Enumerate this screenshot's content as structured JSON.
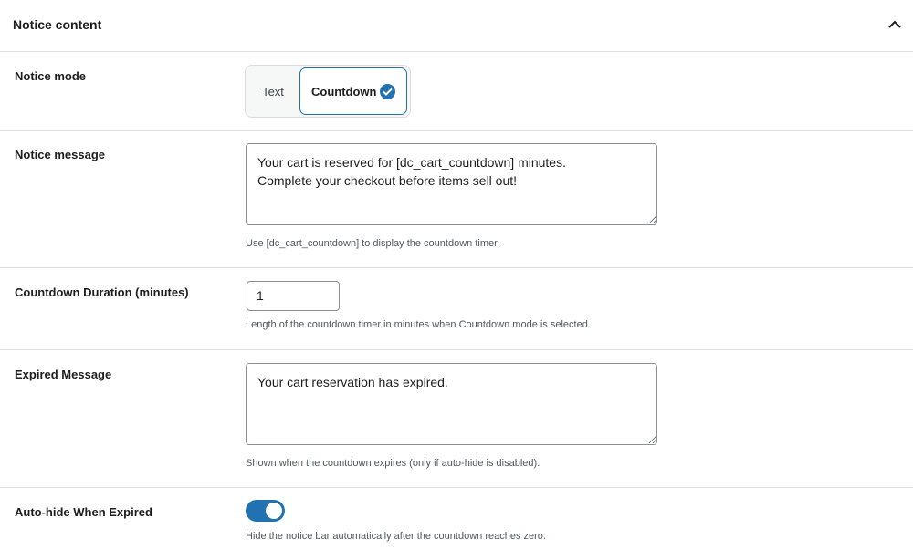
{
  "panel": {
    "title": "Notice content",
    "collapse_icon": "chevron-up-icon"
  },
  "notice_mode": {
    "label": "Notice mode",
    "options": [
      "Text",
      "Countdown"
    ],
    "selected": "Countdown"
  },
  "notice_message": {
    "label": "Notice message",
    "value": "Your cart is reserved for [dc_cart_countdown] minutes.\nComplete your checkout before items sell out!",
    "help": "Use [dc_cart_countdown] to display the countdown timer."
  },
  "countdown_duration": {
    "label": "Countdown Duration (minutes)",
    "value": "1",
    "help": "Length of the countdown timer in minutes when Countdown mode is selected."
  },
  "expired_message": {
    "label": "Expired Message",
    "value": "Your cart reservation has expired.",
    "help": "Shown when the countdown expires (only if auto-hide is disabled)."
  },
  "auto_hide": {
    "label": "Auto-hide When Expired",
    "enabled": true,
    "help": "Hide the notice bar automatically after the countdown reaches zero."
  },
  "colors": {
    "accent": "#2271b1",
    "border": "#e0e0e0",
    "help_text": "#50575e"
  }
}
